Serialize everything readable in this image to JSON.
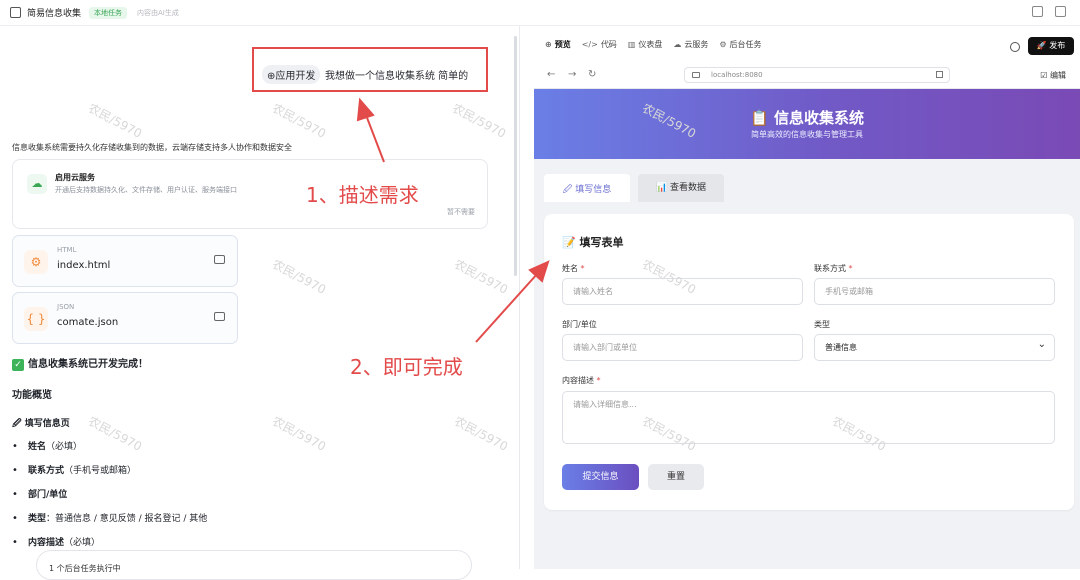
{
  "topbar": {
    "title": "简易信息收集",
    "badge": "本地任务",
    "sub": "内容由AI生成"
  },
  "left": {
    "request": {
      "chip": "⊕应用开发",
      "text": "我想做一个信息收集系统 简单的"
    },
    "desc": "信息收集系统需要持久化存储收集到的数据，云端存储支持多人协作和数据安全",
    "cloud": {
      "title": "启用云服务",
      "sub": "开通后支持数据持久化、文件存储、用户认证、服务端接口",
      "skip": "暂不需要"
    },
    "files": [
      {
        "type": "HTML",
        "name": "index.html",
        "icon": "⚙"
      },
      {
        "type": "JSON",
        "name": "comate.json",
        "icon": "{ }"
      }
    ],
    "done": "信息收集系统已开发完成！",
    "overview": "功能概览",
    "page_title": "🖉 填写信息页",
    "bullets": [
      {
        "bold": "姓名",
        "rest": "（必填）"
      },
      {
        "bold": "联系方式",
        "rest": "（手机号或邮箱）"
      },
      {
        "bold": "部门/单位",
        "rest": ""
      },
      {
        "bold": "类型",
        "rest": "：普通信息 / 意见反馈 / 报名登记 / 其他"
      },
      {
        "bold": "内容描述",
        "rest": "（必填）"
      }
    ],
    "task": "1 个后台任务执行中"
  },
  "annotations": {
    "step1": "1、描述需求",
    "step2": "2、即可完成"
  },
  "watermark": "农民/5970",
  "right": {
    "tabs": [
      {
        "label": "预览",
        "icon": "⊕"
      },
      {
        "label": "代码",
        "icon": "</>"
      },
      {
        "label": "仪表盘",
        "icon": "▥"
      },
      {
        "label": "云服务",
        "icon": "☁"
      },
      {
        "label": "后台任务",
        "icon": "⚙"
      }
    ],
    "publish": "🚀 发布",
    "url": "localhost:8080",
    "edit": "☑ 编辑",
    "hero": {
      "title": "📋 信息收集系统",
      "sub": "简单高效的信息收集与管理工具"
    },
    "form_tabs": [
      "🖉 填写信息",
      "📊 查看数据"
    ],
    "form": {
      "title": "📝 填写表单",
      "name_label": "姓名",
      "name_ph": "请输入姓名",
      "contact_label": "联系方式",
      "contact_ph": "手机号或邮箱",
      "dept_label": "部门/单位",
      "dept_ph": "请输入部门或单位",
      "type_label": "类型",
      "type_value": "普通信息",
      "desc_label": "内容描述",
      "desc_ph": "请输入详细信息...",
      "required_mark": "*",
      "submit": "提交信息",
      "reset": "重置"
    }
  },
  "colors": {
    "accent": "#6b6fd6",
    "annotation": "#e34a4a",
    "success": "#3db35a"
  }
}
